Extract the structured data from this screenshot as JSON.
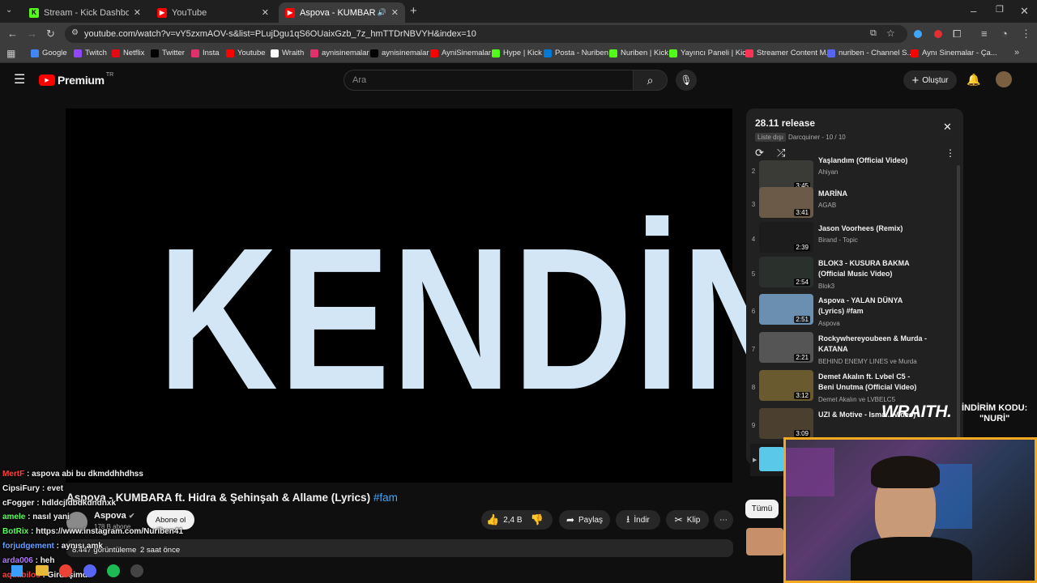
{
  "browser": {
    "tabs": [
      {
        "label": "Stream - Kick Dashboard",
        "color": "#53fc18",
        "glyph": "K"
      },
      {
        "label": "YouTube",
        "color": "#ff0000",
        "glyph": "▶"
      },
      {
        "label": "Aspova - KUMBARA ft. Hidr",
        "color": "#ff0000",
        "glyph": "▶"
      }
    ],
    "url": "youtube.com/watch?v=vY5zxmAOV-s&list=PLujDgu1qS6OUaixGzb_7z_hmTTDrNBVYH&index=10",
    "bookmarks": [
      {
        "label": "Google",
        "color": "#4285f4"
      },
      {
        "label": "Twitch",
        "color": "#9146ff"
      },
      {
        "label": "Netflix",
        "color": "#e50914"
      },
      {
        "label": "Twitter",
        "color": "#000000"
      },
      {
        "label": "Insta",
        "color": "#e1306c"
      },
      {
        "label": "Youtube",
        "color": "#ff0000"
      },
      {
        "label": "Wraith",
        "color": "#ffffff"
      },
      {
        "label": "aynisinemalar",
        "color": "#e1306c"
      },
      {
        "label": "aynisinemalar",
        "color": "#000000"
      },
      {
        "label": "AyniSinemalar",
        "color": "#ff0000"
      },
      {
        "label": "Hype | Kick",
        "color": "#53fc18"
      },
      {
        "label": "Posta - Nuriben",
        "color": "#0078d4"
      },
      {
        "label": "Nuriben | Kick",
        "color": "#53fc18"
      },
      {
        "label": "Yayıncı Paneli | Kick",
        "color": "#53fc18"
      },
      {
        "label": "Streamer Content M...",
        "color": "#ff3355"
      },
      {
        "label": "nuriben - Channel S...",
        "color": "#5865f2"
      },
      {
        "label": "Aynı Sinemalar - Ça...",
        "color": "#ff0000"
      }
    ]
  },
  "yt": {
    "logo": "Premium",
    "region": "TR",
    "search_placeholder": "Ara",
    "create": "Oluştur",
    "video_text": "KENDİNE",
    "title": "Aspova - KUMBARA ft. Hidra & Şehinşah & Allame (Lyrics)",
    "hashtag": "#fam",
    "channel": "Aspova",
    "subs": "178 B abone",
    "subscribe": "Abone ol",
    "likes": "2,4 B",
    "share": "Paylaş",
    "download": "İndir",
    "clip": "Klip",
    "views": "8.447 görüntüleme",
    "ago": "2 saat önce",
    "all": "Tümü"
  },
  "playlist": {
    "title": "28.11 release",
    "meta": "Liste dışı",
    "owner": "Darcquiner - 10 / 10",
    "items": [
      {
        "n": "2",
        "title": "Yaşlandım (Official Video)",
        "channel": "Ahiyan",
        "dur": "3:45",
        "color": "#3a3a36"
      },
      {
        "n": "3",
        "title": "MARİNA",
        "channel": "AGAB",
        "dur": "3:41",
        "color": "#6b5a48"
      },
      {
        "n": "4",
        "title": "Jason Voorhees (Remix)",
        "channel": "Birand - Topic",
        "dur": "2:39",
        "color": "#1c1c1c"
      },
      {
        "n": "5",
        "title": "BLOK3 - KUSURA BAKMA (Official Music Video)",
        "channel": "Blok3",
        "dur": "2:54",
        "color": "#2a302c"
      },
      {
        "n": "6",
        "title": "Aspova - YALAN DÜNYA (Lyrics) #fam",
        "channel": "Aspova",
        "dur": "2:51",
        "color": "#6a8fb0"
      },
      {
        "n": "7",
        "title": "Rockywhereyoubeen & Murda - KATANA",
        "channel": "BEHIND ENEMY LINES ve Murda",
        "dur": "2:21",
        "color": "#555555"
      },
      {
        "n": "8",
        "title": "Demet Akalın ft. Lvbel C5 - Beni Unutma (Official Video)",
        "channel": "Demet Akalın ve LVBELC5",
        "dur": "3:12",
        "color": "#6a5a30"
      },
      {
        "n": "9",
        "title": "UZI & Motive - Isma... Video)",
        "channel": "",
        "dur": "3:09",
        "color": "#4b4030"
      }
    ]
  },
  "overlay": {
    "brand": "WRAITH.",
    "promo1": "İNDİRİM KODU:",
    "promo2": "\"NURİ\""
  },
  "chat": [
    {
      "user": "MertF",
      "msg": "aspova abi bu dkmddhhdhss",
      "color": "#ff4040"
    },
    {
      "user": "CipsiFury",
      "msg": "evet",
      "color": "#f1f1f1"
    },
    {
      "user": "cFogger",
      "msg": "hdldcjldbdkdndnxk",
      "color": "#f1f1f1"
    },
    {
      "user": "amele",
      "msg": "nasıl yani",
      "color": "#5aff5a"
    },
    {
      "user": "BotRix",
      "msg": "https://www.instagram.com/Nuriben41",
      "color": "#5aff5a"
    },
    {
      "user": "forjudgement",
      "msg": "aynısı amk",
      "color": "#6aa0ff"
    },
    {
      "user": "arda006",
      "msg": "heh",
      "color": "#b07aff"
    },
    {
      "user": "aquabilos",
      "msg": "Girdi şimdi",
      "color": "#ff4040"
    }
  ]
}
